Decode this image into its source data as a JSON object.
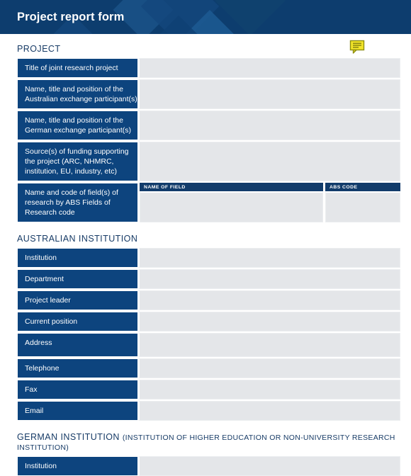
{
  "header": {
    "title": "Project report form",
    "background_color": "#0d3d6e"
  },
  "colors": {
    "label_blue": "#0d447e",
    "heading_blue": "#173b66",
    "input_grey": "#e4e6e9",
    "note_yellow": "#f2e42a"
  },
  "note_icon": {
    "name": "comment-note-icon",
    "color": "#f2e42a",
    "border_color": "#8a8a0e"
  },
  "sections": [
    {
      "id": "project",
      "heading": "PROJECT",
      "subheading": "",
      "rows": [
        {
          "label": "Title of joint research project",
          "value": "",
          "height": "h1"
        },
        {
          "label": "Name, title and position of the Australian exchange participant(s)",
          "value": "",
          "height": "h2"
        },
        {
          "label": "Name, title and position of the German exchange participant(s)",
          "value": "",
          "height": "h2"
        },
        {
          "label": "Source(s) of funding supporting the project (ARC, NHMRC, institution, EU, industry, etc)",
          "value": "",
          "height": "h3"
        }
      ],
      "abs_row": {
        "label": "Name and code of field(s) of research by ABS Fields of Research code",
        "columns": [
          {
            "header": "NAME OF FIELD",
            "value": ""
          },
          {
            "header": "ABS CODE",
            "value": ""
          }
        ]
      }
    },
    {
      "id": "australian-institution",
      "heading": "AUSTRALIAN INSTITUTION",
      "subheading": "",
      "rows": [
        {
          "label": "Institution",
          "value": "",
          "height": "h1"
        },
        {
          "label": "Department",
          "value": "",
          "height": "h1"
        },
        {
          "label": "Project leader",
          "value": "",
          "height": "h1"
        },
        {
          "label": "Current position",
          "value": "",
          "height": "h1"
        },
        {
          "label": "Address",
          "value": "",
          "height": "h-addr"
        },
        {
          "label": "Telephone",
          "value": "",
          "height": "h1"
        },
        {
          "label": "Fax",
          "value": "",
          "height": "h1"
        },
        {
          "label": "Email",
          "value": "",
          "height": "h1"
        }
      ]
    },
    {
      "id": "german-institution",
      "heading": "GERMAN INSTITUTION ",
      "subheading": "(INSTITUTION OF HIGHER EDUCATION OR NON-UNIVERSITY RESEARCH INSTITUTION)",
      "rows": [
        {
          "label": "Institution",
          "value": "",
          "height": "h1"
        }
      ]
    }
  ]
}
